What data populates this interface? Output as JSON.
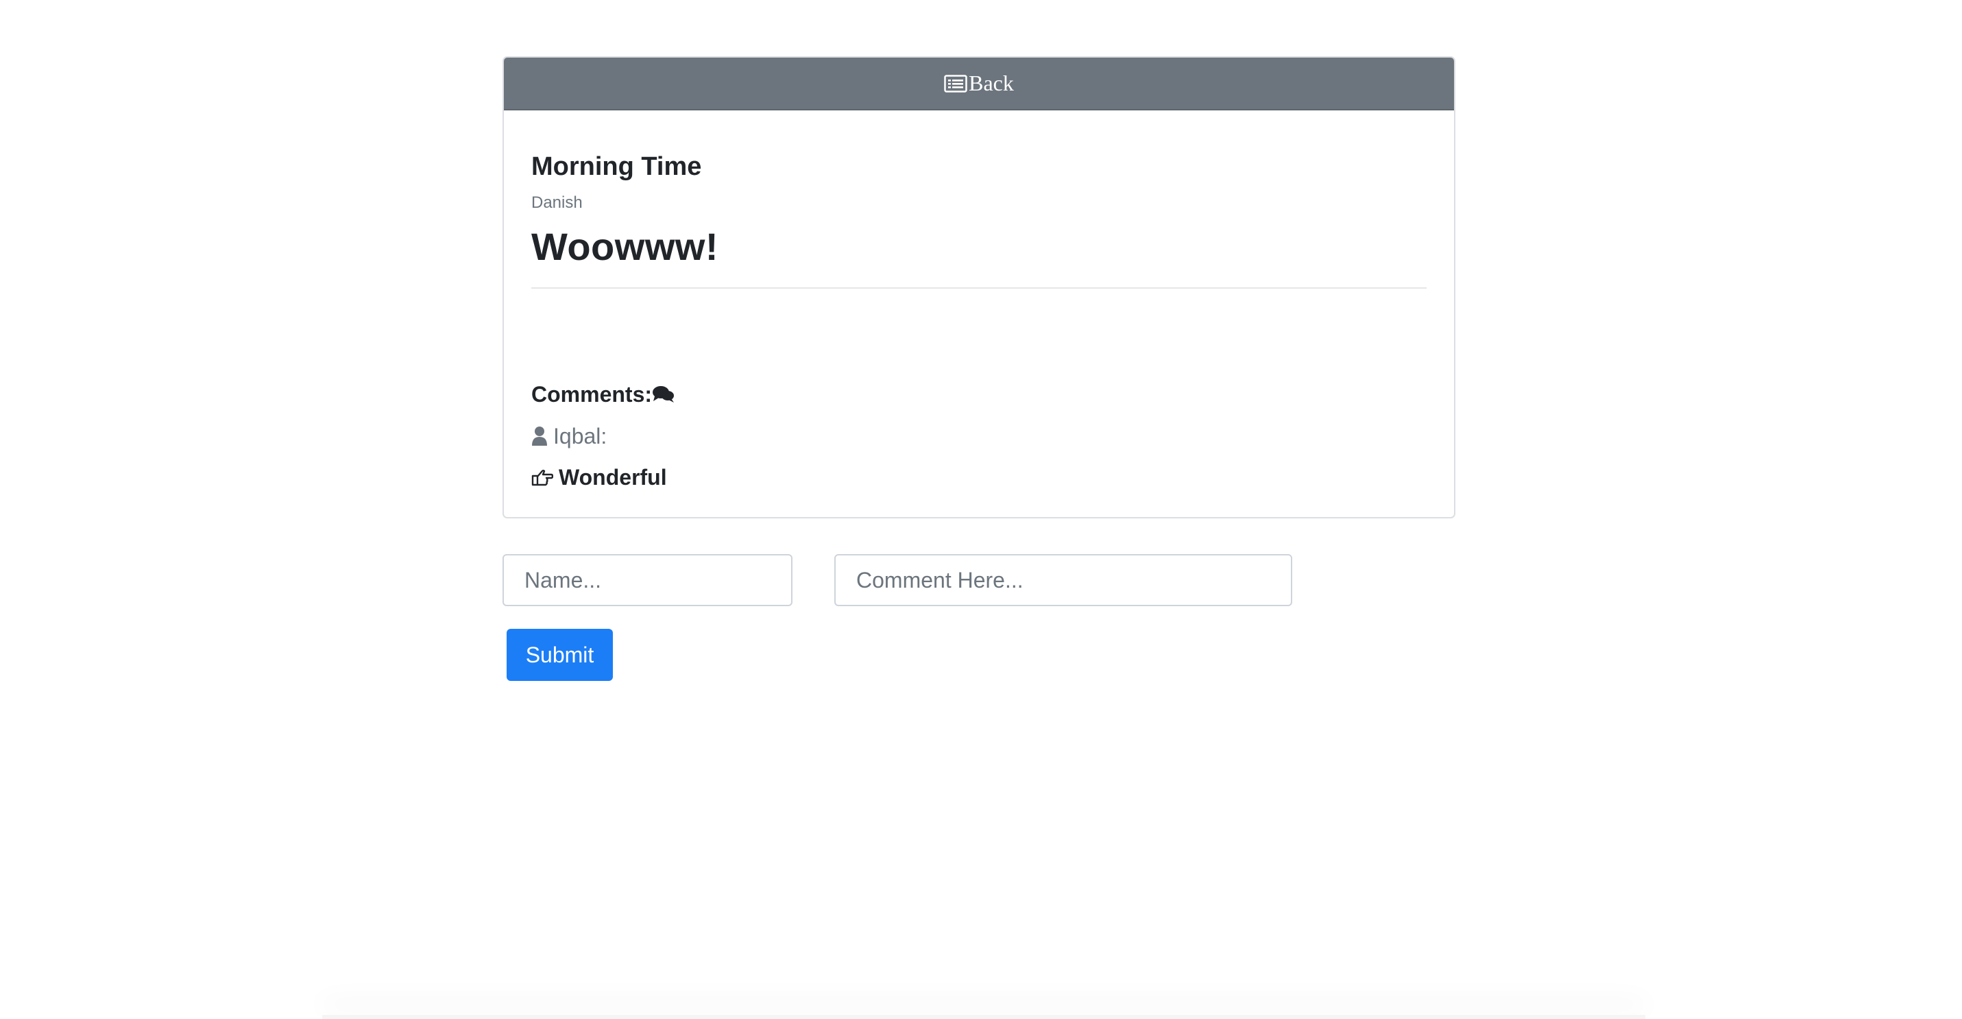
{
  "header": {
    "back_label": "Back",
    "back_icon": "list-alt-icon"
  },
  "post": {
    "title": "Morning Time",
    "author": "Danish",
    "content": "Woowww!"
  },
  "comments": {
    "heading": "Comments:",
    "heading_icon": "comments-icon",
    "items": [
      {
        "user": "Iqbal:",
        "user_icon": "user-icon",
        "text": "Wonderful",
        "text_icon": "hand-point-right-icon"
      }
    ]
  },
  "form": {
    "name_placeholder": "Name...",
    "comment_placeholder": "Comment Here...",
    "submit_label": "Submit"
  },
  "colors": {
    "header_bg": "#6c757d",
    "primary": "#1c7ef6",
    "muted": "#6c757d",
    "text": "#212529"
  }
}
